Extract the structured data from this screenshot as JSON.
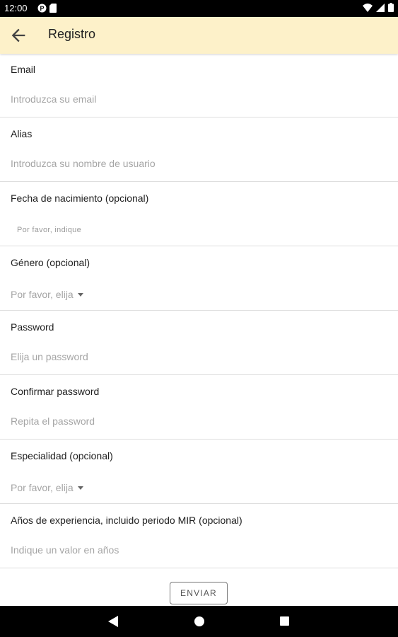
{
  "status_bar": {
    "time": "12:00",
    "icons_left": [
      "p-badge-icon",
      "sim-card-icon"
    ],
    "icons_right": [
      "wifi-icon",
      "signal-icon",
      "battery-icon"
    ]
  },
  "app_bar": {
    "title": "Registro",
    "back_icon": "arrow-back-icon",
    "background": "#fdf1c9"
  },
  "form": {
    "email": {
      "label": "Email",
      "placeholder": "Introduzca su email"
    },
    "alias": {
      "label": "Alias",
      "placeholder": "Introduzca su nombre de usuario"
    },
    "birthdate": {
      "label": "Fecha de nacimiento (opcional)",
      "placeholder": "Por favor, indique"
    },
    "gender": {
      "label": "Género (opcional)",
      "placeholder": "Por favor, elija"
    },
    "password": {
      "label": "Password",
      "placeholder": "Elija un password"
    },
    "confirm_password": {
      "label": "Confirmar password",
      "placeholder": "Repita el password"
    },
    "specialty": {
      "label": "Especialidad (opcional)",
      "placeholder": "Por favor, elija"
    },
    "experience": {
      "label": "Años de experiencia, incluido periodo MIR (opcional)",
      "placeholder": "Indique un valor en años"
    }
  },
  "submit": {
    "label": "ENVIAR"
  },
  "nav_bar": {
    "icons": [
      "nav-back-icon",
      "nav-home-icon",
      "nav-recents-icon"
    ]
  }
}
